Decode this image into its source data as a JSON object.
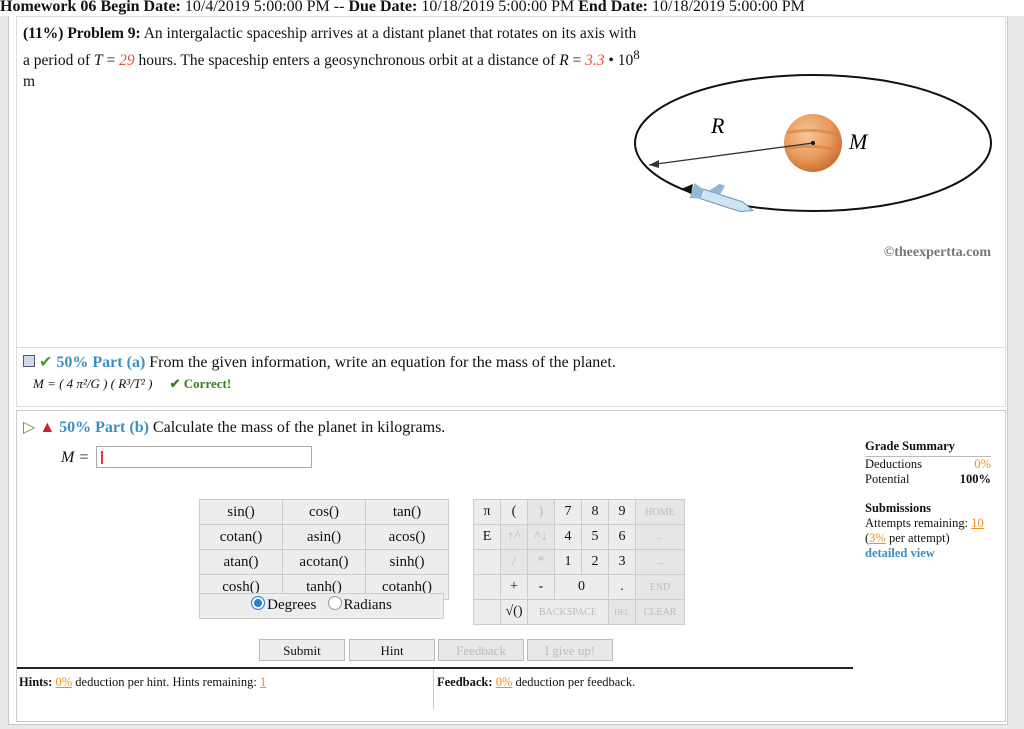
{
  "header": {
    "homework": "Homework 06",
    "begin_label": "Begin Date:",
    "begin_date": "10/4/2019 5:00:00 PM -- ",
    "due_label": "Due Date:",
    "due_date": "10/18/2019 5:00:00 PM",
    "end_label": "End Date:",
    "end_date": "10/18/2019 5:00:00 PM"
  },
  "problem": {
    "weight": "(11%)",
    "title": "Problem 9:",
    "text1": "An intergalactic spaceship arrives at a distant planet that rotates on its axis with a period of",
    "T_label": "T",
    "T_value": "29",
    "text2": "hours. The spaceship enters a geosynchronous orbit at a distance of",
    "R_label": "R",
    "R_value": "3.3",
    "text3": "• 10",
    "exp": "8",
    "unit": "m",
    "diagram_R": "R",
    "diagram_M": "M",
    "credit": "©theexpertta.com"
  },
  "part_a": {
    "pct": "50% Part (a)",
    "text": "From the given information, write an equation for the mass of the planet.",
    "answer": "M = ( 4 π²/G ) ( R³/T² )",
    "status": "✔ Correct!"
  },
  "part_b": {
    "pct": "50% Part (b)",
    "text": "Calculate the mass of the planet in kilograms.",
    "input_label": "M =",
    "input_value": ""
  },
  "grade": {
    "title": "Grade Summary",
    "deductions_label": "Deductions",
    "deductions_value": "0%",
    "potential_label": "Potential",
    "potential_value": "100%",
    "submissions_title": "Submissions",
    "attempts_label": "Attempts remaining:",
    "attempts_value": "10",
    "per_attempt_pct": "3%",
    "per_attempt_label": "per attempt)",
    "detailed": "detailed view"
  },
  "calculator": {
    "funcs": [
      [
        "sin()",
        "cos()",
        "tan()"
      ],
      [
        "cotan()",
        "asin()",
        "acos()"
      ],
      [
        "atan()",
        "acotan()",
        "sinh()"
      ],
      [
        "cosh()",
        "tanh()",
        "cotanh()"
      ]
    ],
    "keys_row1": [
      "π",
      "(",
      ")",
      "7",
      "8",
      "9"
    ],
    "keys_row2": [
      "E",
      "↑^",
      "^↓",
      "4",
      "5",
      "6"
    ],
    "keys_row3": [
      "",
      "/",
      "*",
      "1",
      "2",
      "3"
    ],
    "keys_row4": [
      "",
      "+",
      "-",
      "0",
      "",
      ""
    ],
    "home": "HOME",
    "back_arrow": "←",
    "fwd_arrow": "→",
    "end": "END",
    "dot": ".",
    "sqrt": "√()",
    "backspace": "BACKSPACE",
    "del": "DEL",
    "clear": "CLEAR",
    "degrees": "Degrees",
    "radians": "Radians"
  },
  "buttons": {
    "submit": "Submit",
    "hint": "Hint",
    "feedback": "Feedback",
    "give_up": "I give up!"
  },
  "footer": {
    "hints_label": "Hints:",
    "hints_pct": "0%",
    "hints_text": "deduction per hint. Hints remaining:",
    "hints_remaining": "1",
    "feedback_label": "Feedback:",
    "feedback_pct": "0%",
    "feedback_text": "deduction per feedback."
  },
  "colors": {
    "accent": "#3b8fc2",
    "red": "#e8523b",
    "orange": "#f29020",
    "green": "#3a7d20"
  }
}
